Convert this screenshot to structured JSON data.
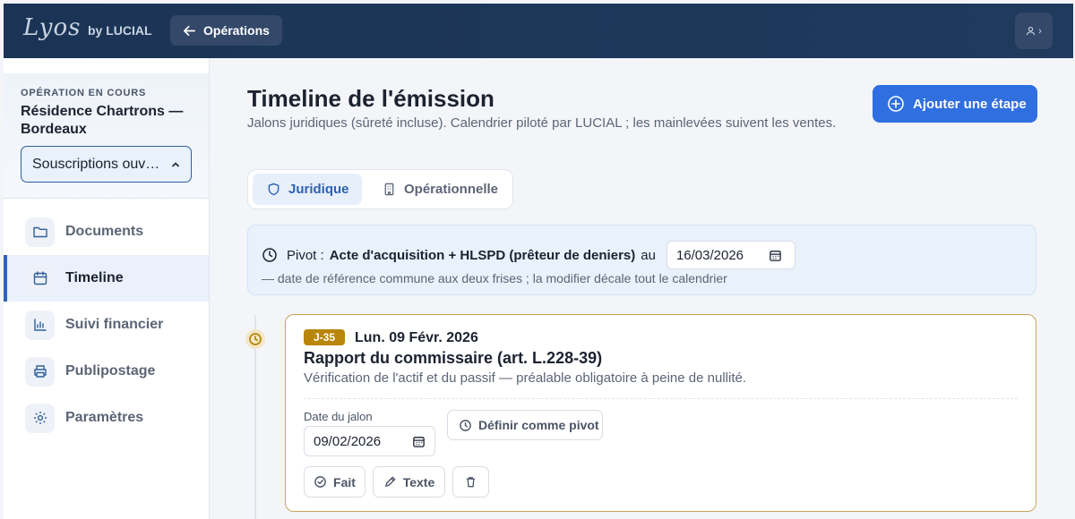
{
  "header": {
    "logo": "Lyos",
    "by": "by LUCIAL",
    "back_label": "Opérations",
    "user_chevron": "›"
  },
  "sidebar": {
    "kicker": "OPÉRATION EN COURS",
    "operation_name": "Résidence Chartrons — Bordeaux",
    "status_value": "Souscriptions ouvertes",
    "items": [
      {
        "label": "Documents",
        "icon": "folder-icon",
        "active": false
      },
      {
        "label": "Timeline",
        "icon": "calendar-icon",
        "active": true
      },
      {
        "label": "Suivi financier",
        "icon": "chart-icon",
        "active": false
      },
      {
        "label": "Publipostage",
        "icon": "printer-icon",
        "active": false
      },
      {
        "label": "Paramètres",
        "icon": "gear-icon",
        "active": false
      }
    ]
  },
  "main": {
    "title": "Timeline de l'émission",
    "subtitle": "Jalons juridiques (sûreté incluse). Calendrier piloté par LUCIAL ; les mainlevées suivent les ventes.",
    "add_label": "Ajouter une étape",
    "tabs": [
      {
        "label": "Juridique",
        "active": true
      },
      {
        "label": "Opérationnelle",
        "active": false
      }
    ],
    "pivot": {
      "prefix": "Pivot :",
      "name": "Acte d'acquisition + HLSPD (prêteur de deniers)",
      "at": "au",
      "date": "16/03/2026",
      "note": "— date de référence commune aux deux frises ; la modifier décale tout le calendrier"
    },
    "milestone": {
      "badge": "J-35",
      "date_label": "Lun. 09 Févr. 2026",
      "title": "Rapport du commissaire (art. L.228-39)",
      "description": "Vérification de l'actif et du passif — préalable obligatoire à peine de nullité.",
      "field_label": "Date du jalon",
      "date_value": "09/02/2026",
      "pivot_button": "Définir comme pivot",
      "done_button": "Fait",
      "text_button": "Texte"
    }
  },
  "colors": {
    "topbar": "#1b3455",
    "accent": "#2f6fe0",
    "milestone_border": "#c9a55a",
    "badge": "#b8860b"
  }
}
